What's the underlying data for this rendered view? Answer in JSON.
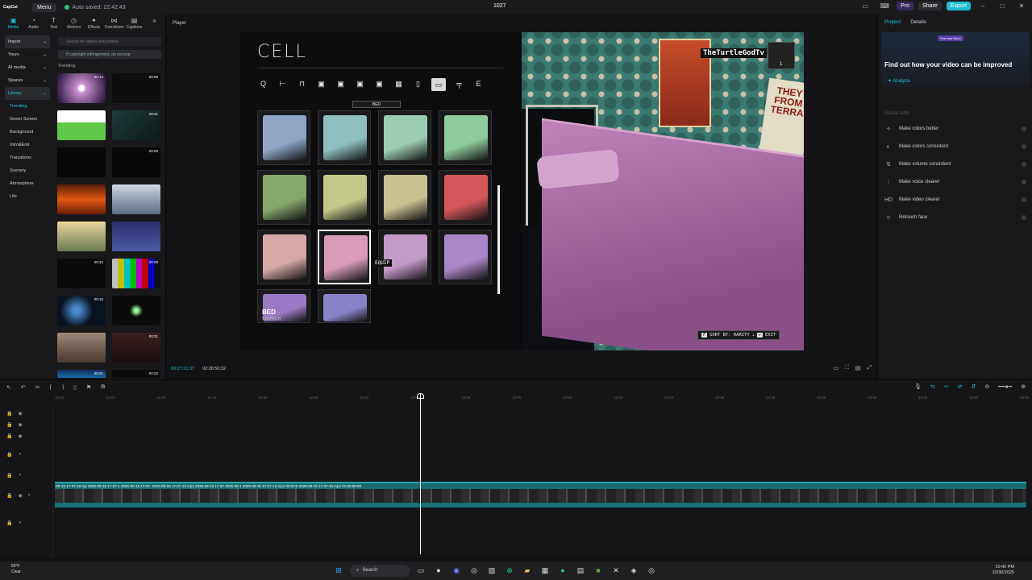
{
  "app": {
    "logo": "CapCut",
    "menu_label": "Menu",
    "autosave": "Auto saved: 22:42:43",
    "project_title": "1027",
    "pro_label": "Pro",
    "share_label": "Share",
    "export_label": "Export"
  },
  "left_panel": {
    "tabs": [
      {
        "label": "Media",
        "icon": "media-icon"
      },
      {
        "label": "Audio",
        "icon": "audio-icon"
      },
      {
        "label": "Text",
        "icon": "text-icon"
      },
      {
        "label": "Stickers",
        "icon": "stickers-icon"
      },
      {
        "label": "Effects",
        "icon": "effects-icon"
      },
      {
        "label": "Transitions",
        "icon": "transitions-icon"
      },
      {
        "label": "Captions",
        "icon": "captions-icon"
      }
    ],
    "side_items": [
      "Import",
      "Yours",
      "AI media",
      "Spaces",
      "Library"
    ],
    "library_sub": [
      "Trending",
      "Green Screen",
      "Background",
      "Intro&End",
      "Transitions",
      "Scenery",
      "Atmosphere",
      "Life"
    ],
    "search_placeholder": "Search for videos and photos",
    "notice": "If copyright infringement, do not exp",
    "trending_label": "Trending",
    "thumb_durations": [
      "00:13",
      "00:09",
      "",
      "00:21",
      "",
      "00:06",
      "",
      "",
      "",
      "",
      "00:34",
      "00:09",
      "00:16",
      "",
      "",
      "00:21",
      "00:21",
      "00:22"
    ]
  },
  "player": {
    "label": "Player",
    "current_time": "00:27:21:37",
    "total_time": "02:26:50:32"
  },
  "game": {
    "title": "CELL",
    "category_label": "BED",
    "equip_label": "EQUIP",
    "item_name": "BED",
    "item_rarity": "COMMON",
    "streamer": "TheTurtleGodTv",
    "avatar_count": "1",
    "sort_key": "F",
    "sort_label": "SORT BY: RARITY",
    "exit_key": "",
    "exit_label": "EXIT",
    "poster_text": "THEY FROM TERRA",
    "bed_colors": [
      "#8fa6c7",
      "#8fbfbf",
      "#9ccdb3",
      "#8ecb9d",
      "#86a86d",
      "#c4c98a",
      "#c8c090",
      "#d4585a",
      "#d6a8a8",
      "#d89bb8",
      "#c49ac9",
      "#a987c8",
      "#9a7ac4",
      "#8a82c8"
    ]
  },
  "right_panel": {
    "tab_project": "Project",
    "tab_details": "Details",
    "badge": "See new this ▸",
    "promo_title": "Find out how your video can be improved",
    "analyze_label": "Analyze",
    "global_label": "Global edits",
    "actions": [
      {
        "label": "Make colors better",
        "icon": "color-wand-icon"
      },
      {
        "label": "Make colors consistent",
        "icon": "consistent-icon"
      },
      {
        "label": "Make volume consistent",
        "icon": "volume-icon"
      },
      {
        "label": "Make voice clearer",
        "icon": "voice-icon"
      },
      {
        "label": "Make video clearer",
        "icon": "hd-icon"
      },
      {
        "label": "Retouch face",
        "icon": "face-icon"
      }
    ]
  },
  "timeline": {
    "ruler_ticks": [
      "12:20",
      "12:25",
      "12:30",
      "12:35",
      "12:40",
      "12:45",
      "12:50",
      "12:55",
      "13:00",
      "13:05",
      "13:10",
      "13:15",
      "13:20",
      "13:25",
      "13:30",
      "13:35",
      "13:40",
      "13:45",
      "13:50",
      "13:55"
    ],
    "clip_labels": "-09-15 17-07-10.mp  2025-09-15 17-07-1  2025-09-15 17-07-  2025-09-15 17-07-10.mp4  2025-09-15 17-07  2025-09-1  2025-09-15 17-07-10.mp4  00:03:5  2025-09-15 17-07-10.mp4  01:59:59:59"
  },
  "taskbar": {
    "temp": "69°F",
    "weather": "Clear",
    "search_label": "Search",
    "time": "10:42 PM",
    "date": "10/30/2025"
  }
}
